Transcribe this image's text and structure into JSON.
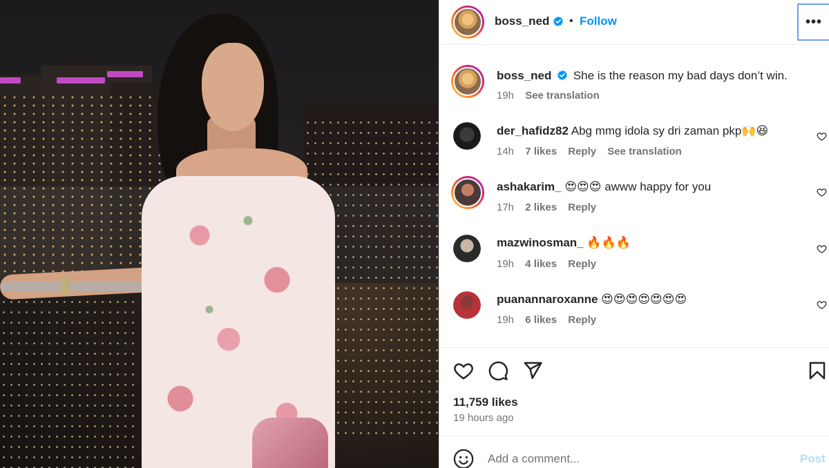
{
  "post": {
    "author": "boss_ned",
    "follow_label": "Follow",
    "separator": "•",
    "more_label": "•••",
    "caption": {
      "user": "boss_ned",
      "text": "She is the reason my bad days don’t win.",
      "time": "19h",
      "see_translation": "See translation"
    },
    "comments": [
      {
        "user": "der_hafidz82",
        "text": "Abg mmg idola sy dri zaman pkp🙌😆",
        "time": "14h",
        "likes": "7 likes",
        "reply": "Reply",
        "see_translation": "See translation"
      },
      {
        "user": "ashakarim_",
        "text": "😍😍😍 awww happy for you",
        "time": "17h",
        "likes": "2 likes",
        "reply": "Reply"
      },
      {
        "user": "mazwinosman_",
        "text": "🔥🔥🔥",
        "time": "19h",
        "likes": "4 likes",
        "reply": "Reply"
      },
      {
        "user": "puanannaroxanne",
        "text": "😍😍😍😍😍😍😍",
        "time": "19h",
        "likes": "6 likes",
        "reply": "Reply"
      }
    ],
    "likes_count": "11,759 likes",
    "posted_ago": "19 hours ago"
  },
  "composer": {
    "placeholder": "Add a comment...",
    "post_label": "Post"
  },
  "icons": {
    "verified": "verified-badge-icon",
    "like": "heart-icon",
    "comment": "comment-icon",
    "share": "share-icon",
    "save": "bookmark-icon",
    "emoji": "emoji-icon",
    "more": "more-options-icon"
  },
  "colors": {
    "accent": "#0095f6",
    "post_disabled": "#b2dffc",
    "muted_text": "#737373"
  }
}
